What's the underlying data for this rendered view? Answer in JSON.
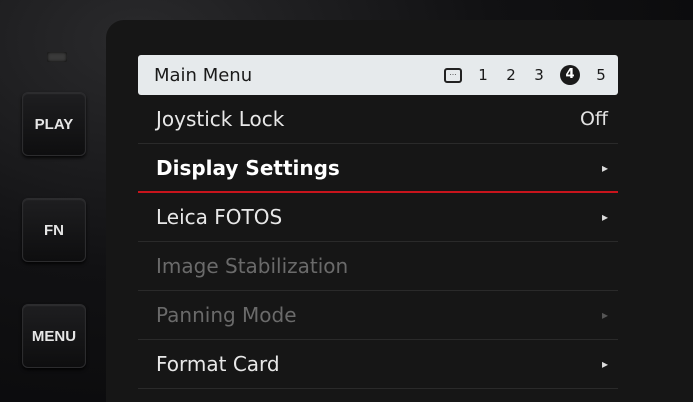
{
  "hardware": {
    "play_label": "PLAY",
    "fn_label": "FN",
    "menu_label": "MENU"
  },
  "header": {
    "title": "Main Menu",
    "page_icon": "camera-page-icon",
    "pages": [
      "1",
      "2",
      "3",
      "4",
      "5"
    ],
    "active_page": "4"
  },
  "menu": {
    "items": [
      {
        "label": "Joystick Lock",
        "value": "Off",
        "state": "enabled"
      },
      {
        "label": "Display Settings",
        "arrow": "▸",
        "state": "selected"
      },
      {
        "label": "Leica FOTOS",
        "arrow": "▸",
        "state": "enabled"
      },
      {
        "label": "Image Stabilization",
        "state": "disabled"
      },
      {
        "label": "Panning Mode",
        "arrow": "▸",
        "state": "disabled"
      },
      {
        "label": "Format Card",
        "arrow": "▸",
        "state": "enabled"
      }
    ]
  },
  "colors": {
    "selection_underline": "#c8141c",
    "header_bg": "#e6eaec"
  }
}
